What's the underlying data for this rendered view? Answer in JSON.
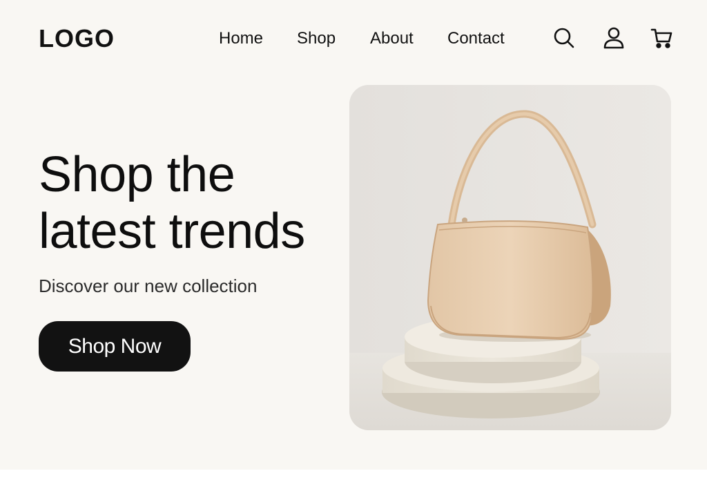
{
  "header": {
    "logo": "LOGO",
    "nav": [
      {
        "label": "Home"
      },
      {
        "label": "Shop"
      },
      {
        "label": "About"
      },
      {
        "label": "Contact"
      }
    ],
    "icons": [
      "search-icon",
      "user-icon",
      "cart-icon"
    ]
  },
  "hero": {
    "title_line1": "Shop the",
    "title_line2": "latest trends",
    "subtitle": "Discover our new collection",
    "cta_label": "Shop Now"
  },
  "product_image": {
    "subject": "beige shoulder bag on round stacked pedestal",
    "bag_color": "#e8ceb0",
    "pedestal_color": "#ebe6da",
    "backdrop_color": "#e6e3df"
  },
  "colors": {
    "page_bg": "#f9f7f3",
    "text": "#111111",
    "button_bg": "#121212",
    "button_text": "#ffffff"
  }
}
